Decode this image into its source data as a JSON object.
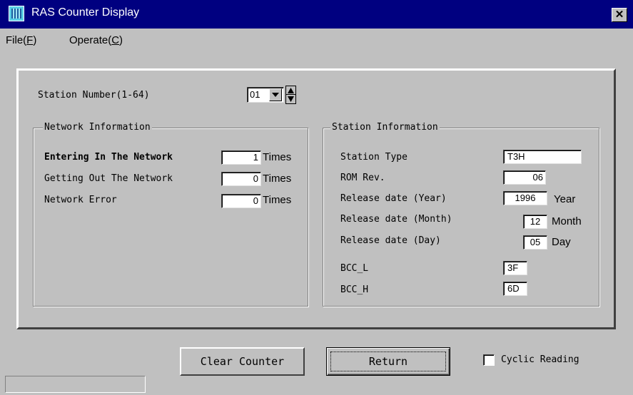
{
  "window": {
    "title": "RAS Counter Display",
    "close_label": "✕"
  },
  "menu": {
    "file": "File(F)",
    "operate": "Operate(C)"
  },
  "station": {
    "label": "Station Number(1-64)",
    "value": "01"
  },
  "network": {
    "title": "Network Information",
    "rows": [
      {
        "label": "Entering In The Network",
        "value": "1",
        "unit": "Times"
      },
      {
        "label": "Getting Out The Network",
        "value": "0",
        "unit": "Times"
      },
      {
        "label": "Network Error",
        "value": "0",
        "unit": "Times"
      }
    ]
  },
  "station_info": {
    "title": "Station Information",
    "station_type": {
      "label": "Station Type",
      "value": "T3H"
    },
    "rom_rev": {
      "label": "ROM Rev.",
      "value": "06"
    },
    "year": {
      "label": "Release date (Year)",
      "value": "1996",
      "unit": "Year"
    },
    "month": {
      "label": "Release date (Month)",
      "value": "12",
      "unit": "Month"
    },
    "day": {
      "label": "Release date (Day)",
      "value": "05",
      "unit": "Day"
    },
    "bcc_l": {
      "label": "BCC_L",
      "value": "3F"
    },
    "bcc_h": {
      "label": "BCC_H",
      "value": "6D"
    }
  },
  "buttons": {
    "clear": "Clear Counter",
    "return": "Return"
  },
  "cyclic": {
    "label": "Cyclic Reading",
    "checked": false
  }
}
